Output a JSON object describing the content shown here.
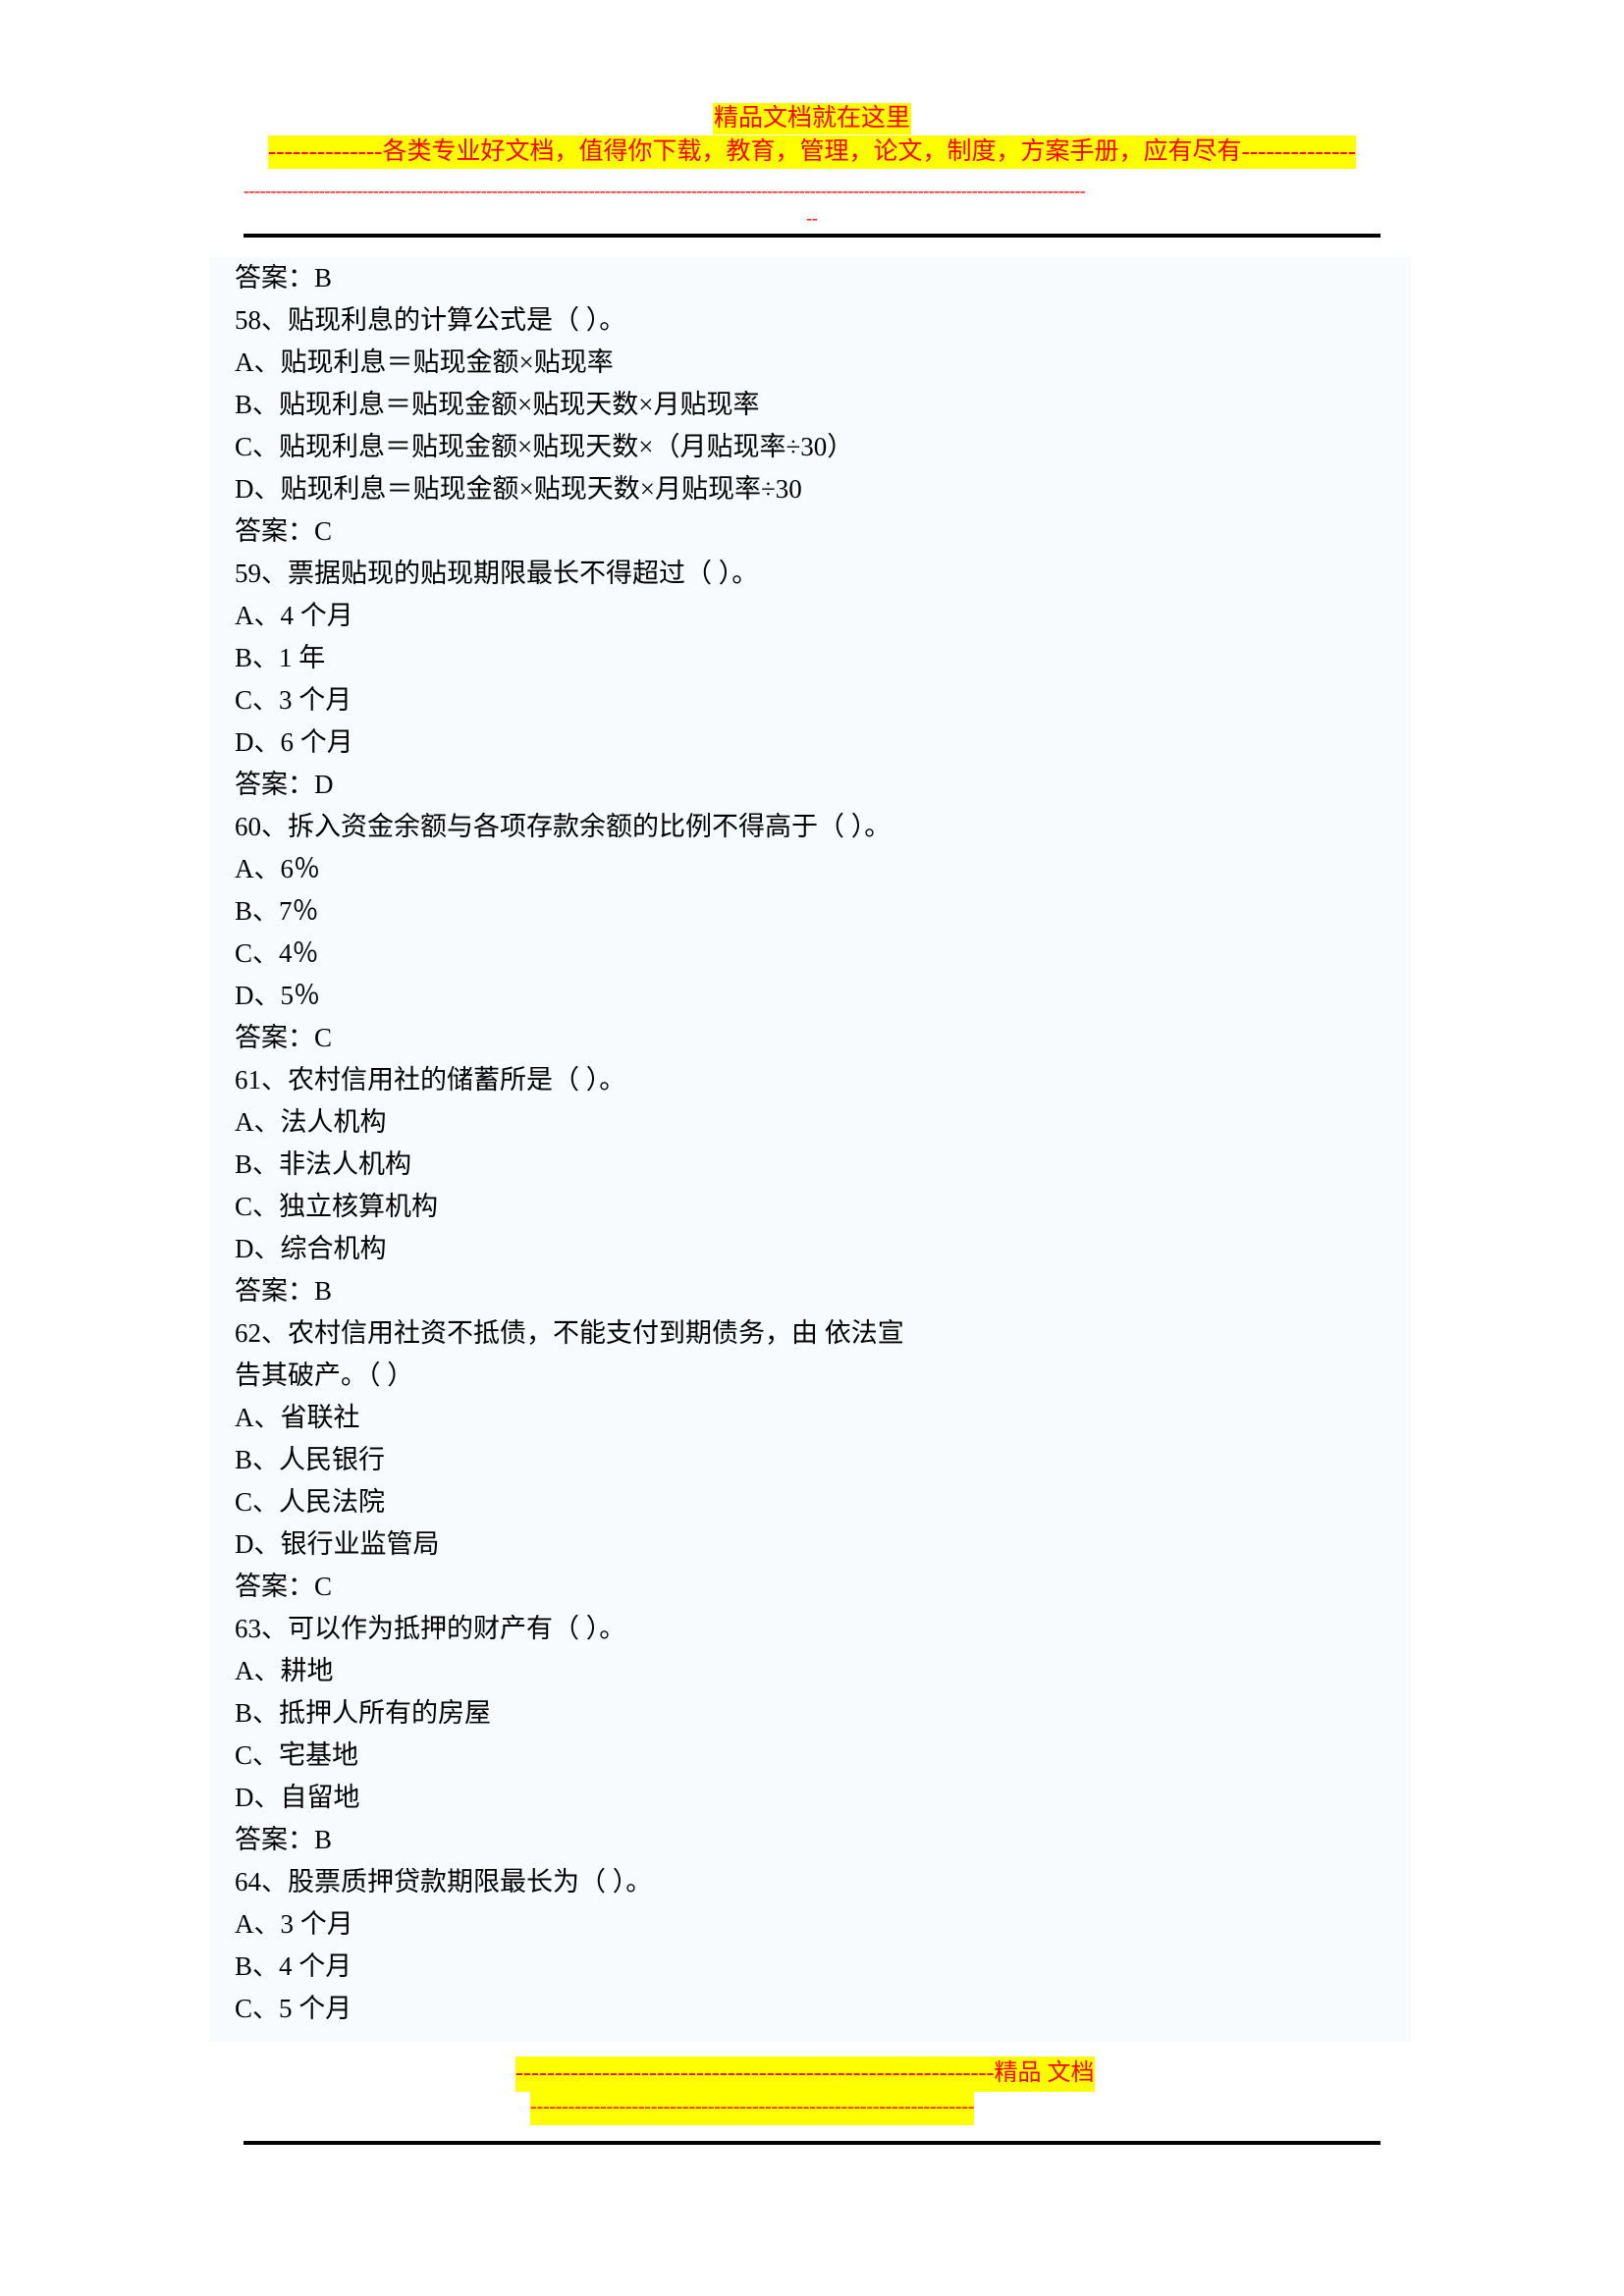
{
  "header": {
    "title_line": "精品文档就在这里",
    "promo_line": "--------------各类专业好文档，值得你下载，教育，管理，论文，制度，方案手册，应有尽有--------------",
    "dash_rule": "------------------------------------------------------------------------------------------------------------------------------------------------------------",
    "dash_small": "--"
  },
  "footer": {
    "line1": "-------------------------------------------------------------精品  文档",
    "line2": "----------------------------------------------------------------------"
  },
  "body_lines": [
    {
      "kind": "ans",
      "text": "答案：B"
    },
    {
      "kind": "qst",
      "text": "58、贴现利息的计算公式是（ ）。"
    },
    {
      "kind": "opt",
      "text": "A、贴现利息＝贴现金额×贴现率"
    },
    {
      "kind": "opt",
      "text": "B、贴现利息＝贴现金额×贴现天数×月贴现率"
    },
    {
      "kind": "opt",
      "text": "C、贴现利息＝贴现金额×贴现天数×（月贴现率÷30）"
    },
    {
      "kind": "opt",
      "text": "D、贴现利息＝贴现金额×贴现天数×月贴现率÷30"
    },
    {
      "kind": "ans",
      "text": "答案：C"
    },
    {
      "kind": "qst",
      "text": "59、票据贴现的贴现期限最长不得超过（ ）。"
    },
    {
      "kind": "opt",
      "text": "A、4 个月"
    },
    {
      "kind": "opt",
      "text": "B、1 年"
    },
    {
      "kind": "opt",
      "text": "C、3 个月"
    },
    {
      "kind": "opt",
      "text": "D、6 个月"
    },
    {
      "kind": "ans",
      "text": "答案：D"
    },
    {
      "kind": "qst",
      "text": "60、拆入资金余额与各项存款余额的比例不得高于（ ）。"
    },
    {
      "kind": "opt",
      "text": "A、6％"
    },
    {
      "kind": "opt",
      "text": "B、7％"
    },
    {
      "kind": "opt",
      "text": "C、4％"
    },
    {
      "kind": "opt",
      "text": "D、5％"
    },
    {
      "kind": "ans",
      "text": "答案：C"
    },
    {
      "kind": "qst",
      "text": "61、农村信用社的储蓄所是（ ）。"
    },
    {
      "kind": "opt",
      "text": "A、法人机构"
    },
    {
      "kind": "opt",
      "text": "B、非法人机构"
    },
    {
      "kind": "opt",
      "text": "C、独立核算机构"
    },
    {
      "kind": "opt",
      "text": "D、综合机构"
    },
    {
      "kind": "ans",
      "text": "答案：B"
    },
    {
      "kind": "qst",
      "text": "62、农村信用社资不抵债，不能支付到期债务，由  依法宣"
    },
    {
      "kind": "cont",
      "text": "告其破产。（ ）"
    },
    {
      "kind": "opt",
      "text": "A、省联社"
    },
    {
      "kind": "opt",
      "text": "B、人民银行"
    },
    {
      "kind": "opt",
      "text": "C、人民法院"
    },
    {
      "kind": "opt",
      "text": "D、银行业监管局"
    },
    {
      "kind": "ans",
      "text": "答案：C"
    },
    {
      "kind": "qst",
      "text": "63、可以作为抵押的财产有（ ）。"
    },
    {
      "kind": "opt",
      "text": "A、耕地"
    },
    {
      "kind": "opt",
      "text": "B、抵押人所有的房屋"
    },
    {
      "kind": "opt",
      "text": "C、宅基地"
    },
    {
      "kind": "opt",
      "text": "D、自留地"
    },
    {
      "kind": "ans",
      "text": "答案：B"
    },
    {
      "kind": "qst",
      "text": "64、股票质押贷款期限最长为（ ）。"
    },
    {
      "kind": "opt",
      "text": "A、3 个月"
    },
    {
      "kind": "opt",
      "text": "B、4 个月"
    },
    {
      "kind": "opt",
      "text": "C、5 个月"
    }
  ],
  "colors": {
    "highlight": "#ffff00",
    "watermark_text": "#ff0000",
    "content_tint": "#f7fbfd",
    "body_text": "#000000",
    "rule": "#000000"
  }
}
